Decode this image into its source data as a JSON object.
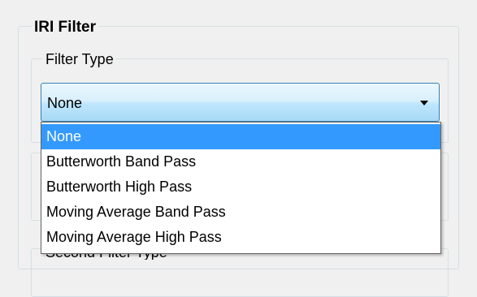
{
  "iri_filter_group": {
    "title": "IRI Filter"
  },
  "filter_type_group": {
    "title": "Filter Type",
    "selected_value": "None",
    "options": [
      "None",
      "Butterworth Band Pass",
      "Butterworth High Pass",
      "Moving Average Band Pass",
      "Moving Average High Pass"
    ],
    "highlighted_index": 0
  },
  "second_filter_type_group": {
    "title": "Second Filter Type"
  },
  "colors": {
    "window_background": "#f0f0f0",
    "combo_border": "#3c7fb1",
    "selection_highlight": "#3399ff",
    "groupbox_border": "#d5dfe5"
  },
  "icons": {
    "combo_arrow": "chevron-down-icon"
  }
}
